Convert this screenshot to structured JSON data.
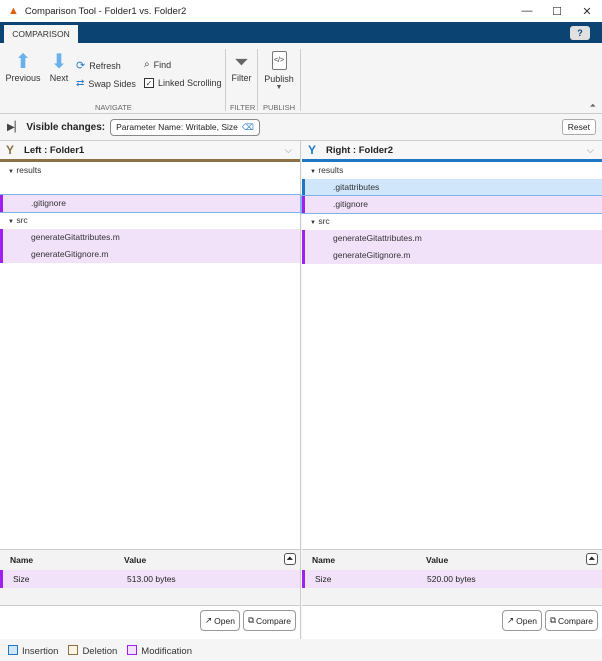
{
  "window": {
    "title": "Comparison Tool - Folder1 vs. Folder2"
  },
  "tab": "COMPARISON",
  "help": "?",
  "ribbon": {
    "previous": "Previous",
    "next": "Next",
    "refresh": "Refresh",
    "swap_sides": "Swap Sides",
    "find": "Find",
    "linked_scrolling": "Linked Scrolling",
    "filter": "Filter",
    "publish": "Publish",
    "groups": {
      "navigate": "NAVIGATE",
      "filter": "FILTER",
      "publish": "PUBLISH"
    }
  },
  "visible_changes": {
    "label": "Visible changes:",
    "chip": "Parameter Name: Writable, Size",
    "reset": "Reset"
  },
  "left": {
    "title": "Left : Folder1",
    "tree": {
      "results": "results",
      "gitignore": ".gitignore",
      "src": "src",
      "file1": "generateGitattributes.m",
      "file2": "generateGitignore.m"
    },
    "props": {
      "name_header": "Name",
      "value_header": "Value",
      "rows": [
        {
          "name": "Size",
          "value": "513.00 bytes"
        }
      ]
    }
  },
  "right": {
    "title": "Right : Folder2",
    "tree": {
      "results": "results",
      "gitattributes": ".gitattributes",
      "gitignore": ".gitignore",
      "src": "src",
      "file1": "generateGitattributes.m",
      "file2": "generateGitignore.m"
    },
    "props": {
      "name_header": "Name",
      "value_header": "Value",
      "rows": [
        {
          "name": "Size",
          "value": "520.00 bytes"
        }
      ]
    }
  },
  "buttons": {
    "open": "Open",
    "compare": "Compare"
  },
  "legend": {
    "insertion": "Insertion",
    "deletion": "Deletion",
    "modification": "Modification"
  },
  "colors": {
    "insertion": "#1f77c4",
    "deletion": "#8a7146",
    "modification": "#a020f0",
    "tabstrip": "#0b4473"
  }
}
